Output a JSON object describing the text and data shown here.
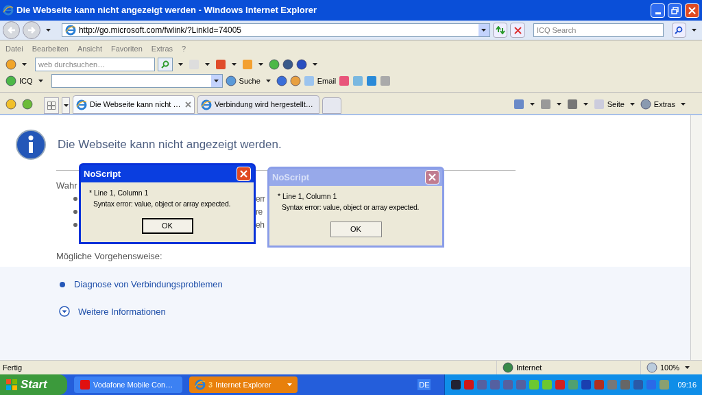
{
  "window": {
    "title": "Die Webseite kann nicht angezeigt werden - Windows Internet Explorer"
  },
  "address_bar": {
    "url": "http://go.microsoft.com/fwlink/?LinkId=74005"
  },
  "search": {
    "placeholder": "ICQ Search"
  },
  "menu": [
    "Datei",
    "Bearbeiten",
    "Ansicht",
    "Favoriten",
    "Extras",
    "?"
  ],
  "web_search": {
    "placeholder": "web durchsuchen…"
  },
  "icq_toolbar": {
    "label": "ICQ",
    "search_label": "Suche",
    "email_label": "Email"
  },
  "tabs": [
    {
      "label": "Die Webseite kann nicht …",
      "selected": true
    },
    {
      "label": "Verbindung wird hergestellt…",
      "selected": false
    }
  ],
  "command_bar": {
    "page": "Seite",
    "tools": "Extras"
  },
  "page": {
    "heading": "Die Webseite kann nicht angezeigt werden.",
    "intro": "Wahr",
    "bullets": [
      "err",
      "re",
      "eh"
    ],
    "options_heading": "Mögliche Vorgehensweise:",
    "actions": [
      {
        "label": "Diagnose von Verbindungsproblemen",
        "kind": "bullet"
      },
      {
        "label": "Weitere Informationen",
        "kind": "expand"
      }
    ]
  },
  "dialogs": [
    {
      "title": "NoScript",
      "line1": "* Line 1, Column 1",
      "line2": "Syntax error: value, object or array expected.",
      "button": "OK",
      "active": true
    },
    {
      "title": "NoScript",
      "line1": "* Line 1, Column 1",
      "line2": "Syntax error: value, object or array expected.",
      "button": "OK",
      "active": false
    }
  ],
  "status_bar": {
    "text": "Fertig",
    "zone": "Internet",
    "zoom": "100%"
  },
  "taskbar": {
    "start": "Start",
    "buttons": [
      {
        "label": "Vodafone Mobile Con…",
        "selected": false
      },
      {
        "label": "Internet Explorer",
        "count": "3",
        "selected": true
      }
    ],
    "language": "DE",
    "clock": "09:16"
  }
}
